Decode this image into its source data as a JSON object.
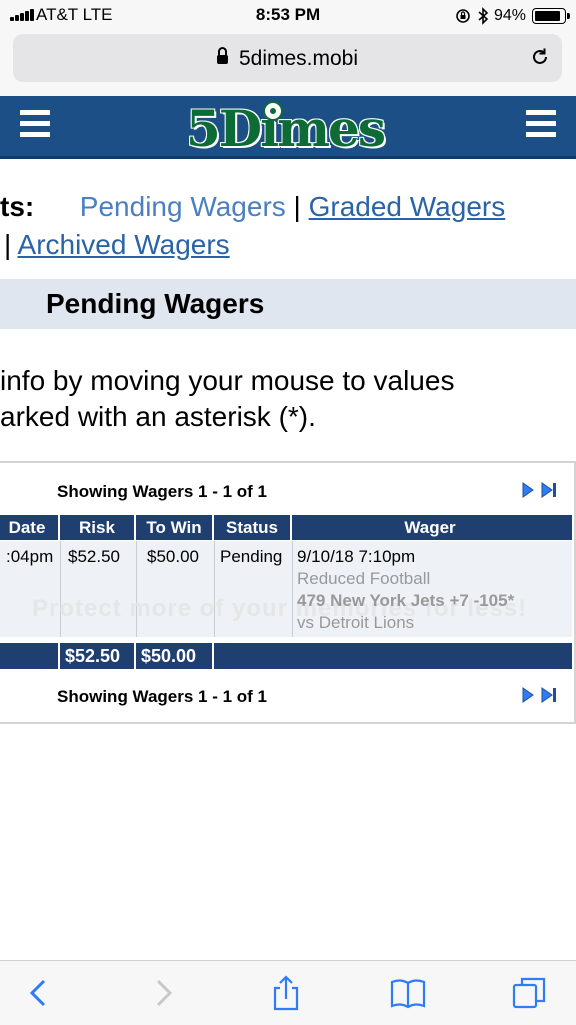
{
  "status_bar": {
    "carrier": "AT&T  LTE",
    "time": "8:53 PM",
    "battery": "94%"
  },
  "browser": {
    "url": "5dimes.mobi"
  },
  "site": {
    "logo": "5Dimes"
  },
  "nav": {
    "lead": "ts:",
    "pending": "Pending Wagers",
    "sep": "|",
    "graded": "Graded Wagers",
    "archived": "Archived Wagers"
  },
  "section_title": "Pending Wagers",
  "info": {
    "line1": "info by moving your mouse to values",
    "line2": "arked with an asterisk (*)."
  },
  "table": {
    "showing_top": "Showing Wagers 1 - 1 of 1",
    "showing_bottom": "Showing Wagers 1 - 1 of 1",
    "headers": {
      "date": "Date",
      "risk": "Risk",
      "to_win": "To Win",
      "status": "Status",
      "wager": "Wager"
    },
    "row": {
      "date": ":04pm",
      "risk": "$52.50",
      "to_win": "$50.00",
      "status": "Pending",
      "wager_date": "9/10/18 7:10pm",
      "wager_type": "Reduced Football",
      "wager_pick": "479 New York Jets +7 -105*",
      "wager_opponent": "vs Detroit Lions"
    },
    "totals": {
      "risk": "$52.50",
      "to_win": "$50.00"
    },
    "watermark": "Protect more of your memories for less!"
  },
  "colors": {
    "header_blue": "#1b4f86",
    "table_blue": "#1f3f70",
    "link_blue": "#2a63a8",
    "ios_blue": "#2f7cf6"
  },
  "toolbar": {
    "icons": [
      "back-icon",
      "forward-icon",
      "share-icon",
      "bookmarks-icon",
      "tabs-icon"
    ]
  }
}
